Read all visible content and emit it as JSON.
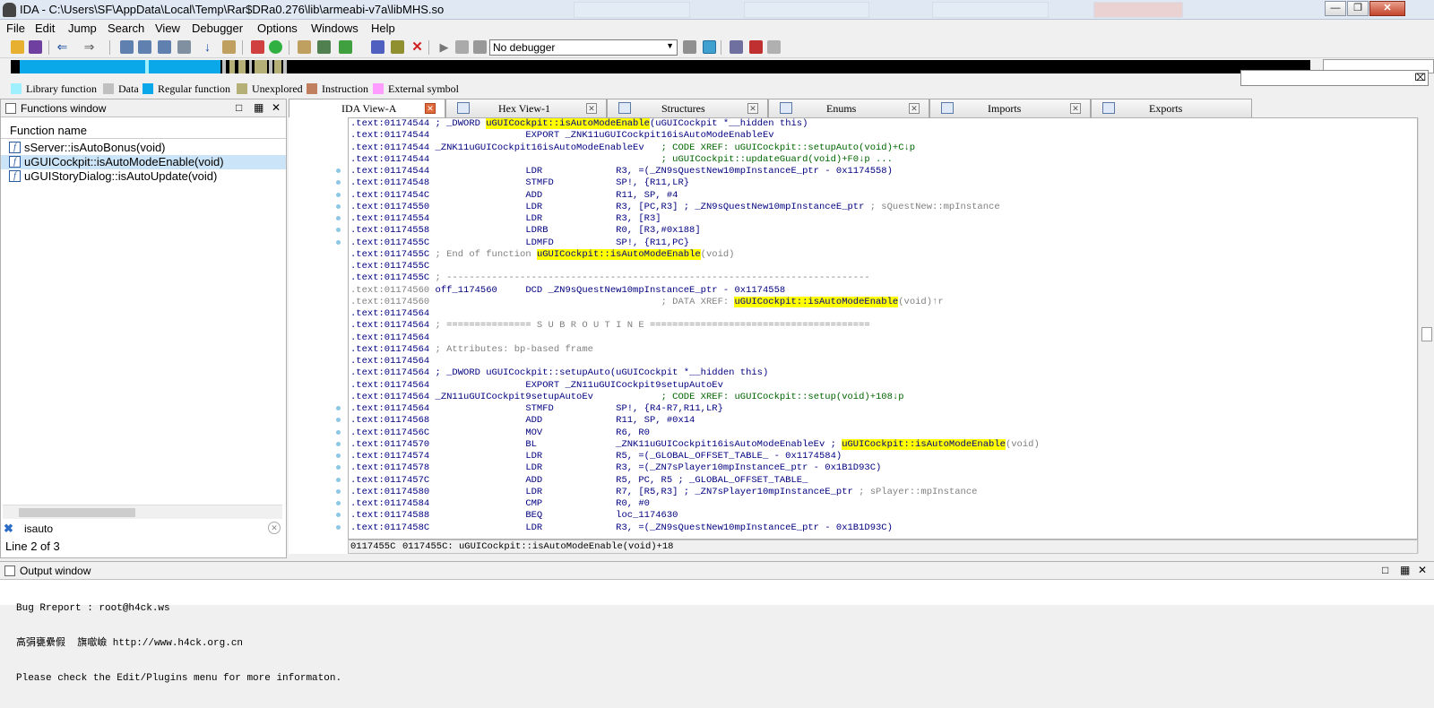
{
  "window": {
    "title": "IDA - C:\\Users\\SF\\AppData\\Local\\Temp\\Rar$DRa0.276\\lib\\armeabi-v7a\\libMHS.so",
    "min": "—",
    "max": "❐",
    "close": "✕"
  },
  "menu": [
    "File",
    "Edit",
    "Jump",
    "Search",
    "View",
    "Debugger",
    "Options",
    "Windows",
    "Help"
  ],
  "toolbar": {
    "debugger_select": "No debugger"
  },
  "legend": [
    {
      "label": "Library function",
      "color": "#9ff0ff"
    },
    {
      "label": "Data",
      "color": "#c0c0c0"
    },
    {
      "label": "Regular function",
      "color": "#0aa8e8"
    },
    {
      "label": "Unexplored",
      "color": "#b4b078"
    },
    {
      "label": "Instruction",
      "color": "#c08060"
    },
    {
      "label": "External symbol",
      "color": "#ff9cff"
    }
  ],
  "functions_window": {
    "title": "Functions window",
    "column": "Function name",
    "items": [
      {
        "name": "sServer::isAutoBonus(void)",
        "selected": false
      },
      {
        "name": "uGUICockpit::isAutoModeEnable(void)",
        "selected": true
      },
      {
        "name": "uGUIStoryDialog::isAutoUpdate(void)",
        "selected": false
      }
    ],
    "filter": "isauto",
    "line_info": "Line 2 of 3"
  },
  "tabs": [
    {
      "label": "IDA View-A",
      "active": true
    },
    {
      "label": "Hex View-1",
      "active": false
    },
    {
      "label": "Structures",
      "active": false
    },
    {
      "label": "Enums",
      "active": false
    },
    {
      "label": "Imports",
      "active": false
    },
    {
      "label": "Exports",
      "active": false
    }
  ],
  "disasm": [
    [
      {
        "t": ".text:01174544 ",
        "c": "a"
      },
      {
        "t": "; _DWORD ",
        "c": "a"
      },
      {
        "t": "uGUICockpit::isAutoModeEnable",
        "c": "hl"
      },
      {
        "t": "(uGUICockpit *__hidden this)",
        "c": "a"
      }
    ],
    [
      {
        "t": ".text:01174544                 EXPORT _ZNK11uGUICockpit16isAutoModeEnableEv",
        "c": "a"
      }
    ],
    [
      {
        "t": ".text:01174544 _ZNK11uGUICockpit16isAutoModeEnableEv   ",
        "c": "a"
      },
      {
        "t": "; CODE XREF: uGUICockpit::setupAuto(void)+C↓p",
        "c": "x"
      }
    ],
    [
      {
        "t": ".text:01174544                                         ",
        "c": "a"
      },
      {
        "t": "; uGUICockpit::updateGuard(void)+F0↓p ...",
        "c": "x"
      }
    ],
    [
      {
        "t": ".text:01174544                 LDR             R3, =(_ZN9sQuestNew10mpInstanceE_ptr - 0x1174558)",
        "c": "a"
      }
    ],
    [
      {
        "t": ".text:01174548                 STMFD           SP!, {R11,LR}",
        "c": "a"
      }
    ],
    [
      {
        "t": ".text:0117454C                 ADD             R11, SP, #4",
        "c": "a"
      }
    ],
    [
      {
        "t": ".text:01174550                 LDR             R3, [PC,R3] ; _ZN9sQuestNew10mpInstanceE_ptr ",
        "c": "a"
      },
      {
        "t": "; sQuestNew::mpInstance",
        "c": "c"
      }
    ],
    [
      {
        "t": ".text:01174554                 LDR             R3, [R3]",
        "c": "a"
      }
    ],
    [
      {
        "t": ".text:01174558                 LDRB            R0, [R3,#0x188]",
        "c": "a"
      }
    ],
    [
      {
        "t": ".text:0117455C                 LDMFD           SP!, {R11,PC}",
        "c": "a"
      }
    ],
    [
      {
        "t": ".text:0117455C ",
        "c": "a"
      },
      {
        "t": "; End of function ",
        "c": "c"
      },
      {
        "t": "uGUICockpit::isAutoModeEnable",
        "c": "hl"
      },
      {
        "t": "(void)",
        "c": "c"
      }
    ],
    [
      {
        "t": ".text:0117455C",
        "c": "a"
      }
    ],
    [
      {
        "t": ".text:0117455C ",
        "c": "a"
      },
      {
        "t": "; ---------------------------------------------------------------------------",
        "c": "c"
      }
    ],
    [
      {
        "t": ".text:01174560 ",
        "c": "g"
      },
      {
        "t": "off_1174560     DCD _ZN9sQuestNew10mpInstanceE_ptr - 0x1174558",
        "c": "a"
      }
    ],
    [
      {
        "t": ".text:01174560                                         ",
        "c": "g"
      },
      {
        "t": "; DATA XREF: ",
        "c": "c"
      },
      {
        "t": "uGUICockpit::isAutoModeEnable",
        "c": "hl"
      },
      {
        "t": "(void)↑r",
        "c": "c"
      }
    ],
    [
      {
        "t": ".text:01174564",
        "c": "a"
      }
    ],
    [
      {
        "t": ".text:01174564 ",
        "c": "a"
      },
      {
        "t": "; =============== S U B R O U T I N E =======================================",
        "c": "c"
      }
    ],
    [
      {
        "t": ".text:01174564",
        "c": "a"
      }
    ],
    [
      {
        "t": ".text:01174564 ",
        "c": "a"
      },
      {
        "t": "; Attributes: bp-based frame",
        "c": "c"
      }
    ],
    [
      {
        "t": ".text:01174564",
        "c": "a"
      }
    ],
    [
      {
        "t": ".text:01174564 ; _DWORD uGUICockpit::setupAuto(uGUICockpit *__hidden this)",
        "c": "a"
      }
    ],
    [
      {
        "t": ".text:01174564                 EXPORT _ZN11uGUICockpit9setupAutoEv",
        "c": "a"
      }
    ],
    [
      {
        "t": ".text:01174564 _ZN11uGUICockpit9setupAutoEv            ",
        "c": "a"
      },
      {
        "t": "; CODE XREF: uGUICockpit::setup(void)+108↓p",
        "c": "x"
      }
    ],
    [
      {
        "t": ".text:01174564                 STMFD           SP!, {R4-R7,R11,LR}",
        "c": "a"
      }
    ],
    [
      {
        "t": ".text:01174568                 ADD             R11, SP, #0x14",
        "c": "a"
      }
    ],
    [
      {
        "t": ".text:0117456C                 MOV             R6, R0",
        "c": "a"
      }
    ],
    [
      {
        "t": ".text:01174570                 BL              _ZNK11uGUICockpit16isAutoModeEnableEv ; ",
        "c": "a"
      },
      {
        "t": "uGUICockpit::isAutoModeEnable",
        "c": "hl"
      },
      {
        "t": "(void)",
        "c": "c"
      }
    ],
    [
      {
        "t": ".text:01174574                 LDR             R5, =(_GLOBAL_OFFSET_TABLE_ - 0x1174584)",
        "c": "a"
      }
    ],
    [
      {
        "t": ".text:01174578                 LDR             R3, =(_ZN7sPlayer10mpInstanceE_ptr - 0x1B1D93C)",
        "c": "a"
      }
    ],
    [
      {
        "t": ".text:0117457C                 ADD             R5, PC, R5 ; _GLOBAL_OFFSET_TABLE_",
        "c": "a"
      }
    ],
    [
      {
        "t": ".text:01174580                 LDR             R7, [R5,R3] ; _ZN7sPlayer10mpInstanceE_ptr ",
        "c": "a"
      },
      {
        "t": "; sPlayer::mpInstance",
        "c": "c"
      }
    ],
    [
      {
        "t": ".text:01174584                 CMP             R0, #0",
        "c": "a"
      }
    ],
    [
      {
        "t": ".text:01174588                 BEQ             loc_1174630",
        "c": "a"
      }
    ],
    [
      {
        "t": ".text:0117458C                 LDR             R3, =(_ZN9sQuestNew10mpInstanceE_ptr - 0x1B1D93C)",
        "c": "a"
      }
    ]
  ],
  "status": {
    "offset": "0117455C",
    "location": "0117455C: uGUICockpit::isAutoModeEnable(void)+18"
  },
  "output_window": {
    "title": "Output window",
    "lines": [
      "Bug Rreport : root@h4ck.ws",
      "高弲甕纍假  旗噷嶮 http://www.h4ck.org.cn",
      "Please check the Edit/Plugins menu for more informaton."
    ]
  }
}
